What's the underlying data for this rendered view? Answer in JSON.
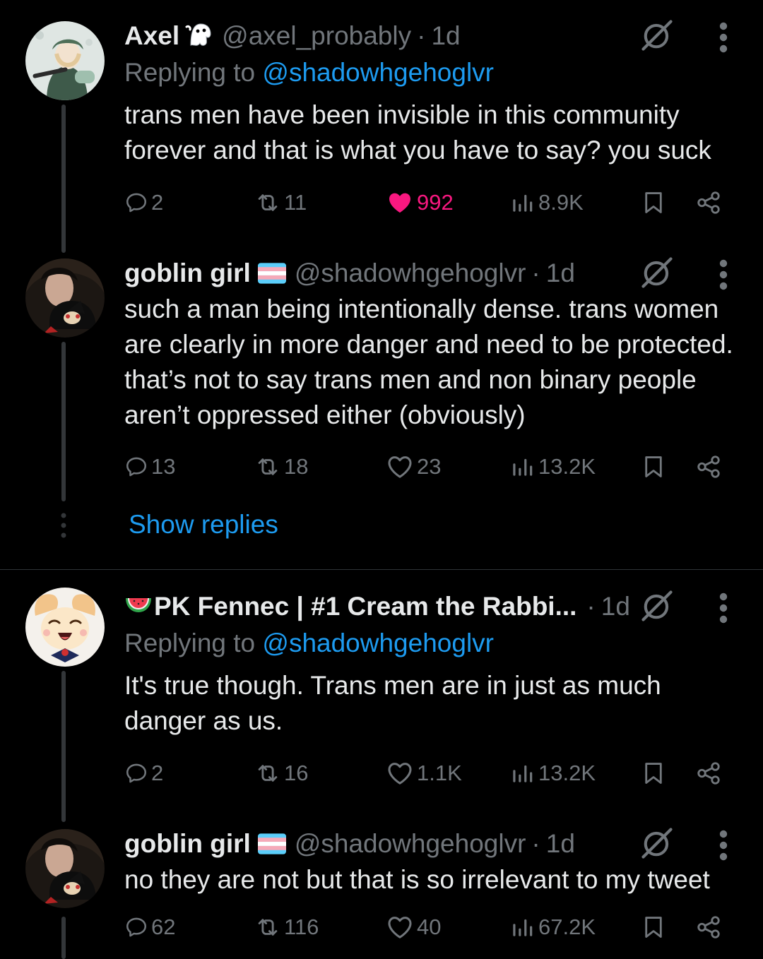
{
  "colors": {
    "background": "#000000",
    "text": "#e7e9ea",
    "muted": "#71767b",
    "link": "#1d9bf0",
    "like": "#f91880",
    "divider": "#2f3336"
  },
  "replying_prefix": "Replying to",
  "show_replies": "Show replies",
  "tweets": [
    {
      "name": "Axel",
      "badge_icon": "ghost-emoji",
      "handle": "@axel_probably",
      "dot": "·",
      "time": "1d",
      "replying_to": "@shadowhgehoglvr",
      "text": "trans men have been invisible in this community forever and that is what you have to say? you suck",
      "replies": "2",
      "retweets": "11",
      "likes": "992",
      "views": "8.9K",
      "liked": true
    },
    {
      "name": "goblin girl",
      "badge_icon": "transgender-flag-emoji",
      "handle": "@shadowhgehoglvr",
      "dot": "·",
      "time": "1d",
      "text": "such a man being intentionally dense. trans women are clearly in more danger and need to be protected. that’s not to say trans men and non binary people aren’t oppressed either (obviously)",
      "replies": "13",
      "retweets": "18",
      "likes": "23",
      "views": "13.2K",
      "liked": false
    },
    {
      "name": "PK Fennec | #1 Cream the Rabbi...",
      "prefix_icon": "watermelon-emoji",
      "dot": "·",
      "time": "1d",
      "replying_to": "@shadowhgehoglvr",
      "text": "It's true though. Trans men are in just as much danger as us.",
      "replies": "2",
      "retweets": "16",
      "likes": "1.1K",
      "views": "13.2K",
      "liked": false
    },
    {
      "name": "goblin girl",
      "badge_icon": "transgender-flag-emoji",
      "handle": "@shadowhgehoglvr",
      "dot": "·",
      "time": "1d",
      "text": "no they are not but that is so irrelevant to my tweet",
      "replies": "62",
      "retweets": "116",
      "likes": "40",
      "views": "67.2K",
      "liked": false
    }
  ]
}
